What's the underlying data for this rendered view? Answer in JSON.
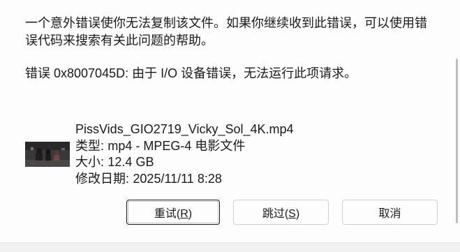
{
  "message": {
    "lines": [
      "一个意外错误使你无法复制该文件。如果你继续收到此错误，可以使用错",
      "误代码来搜索有关此问题的帮助。"
    ],
    "error_line": "错误 0x8007045D: 由于 I/O 设备错误，无法运行此项请求。"
  },
  "file": {
    "thumbnail_icon": "video-thumbnail",
    "name": "PissVids_GIO2719_Vicky_Sol_4K.mp4",
    "type": {
      "label": "类型:",
      "value": "mp4 - MPEG-4 电影文件"
    },
    "size": {
      "label": "大小:",
      "value": "12.4 GB"
    },
    "modified": {
      "label": "修改日期:",
      "value": "2025/11/11 8:28"
    }
  },
  "buttons": {
    "retry": {
      "prefix": "重试(",
      "accelerator": "R",
      "suffix": ")"
    },
    "skip": {
      "prefix": "跳过(",
      "accelerator": "S",
      "suffix": ")"
    },
    "cancel": {
      "label": "取消"
    }
  }
}
